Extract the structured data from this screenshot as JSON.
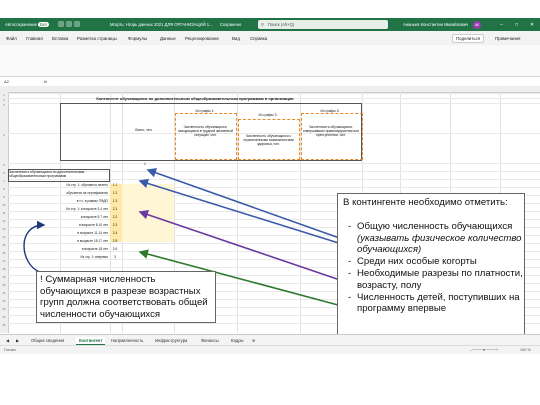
{
  "titlebar": {
    "autosave_label": "Автосохранение",
    "autosave_state": "Вкл",
    "doc_title": "Мгорть: Нгорь данных 2021 ДЛЯ ОРГАНИЗАЦИЙ 1...",
    "saved_status": "Сохранено",
    "search_placeholder": "Поиск (Alt+Q)",
    "user_name": "Ананьев Константин Михайлович",
    "user_initials": "АК"
  },
  "menu": {
    "items": [
      "Файл",
      "Главная",
      "Вставка",
      "Разметка страницы",
      "Формулы",
      "Данные",
      "Рецензирование",
      "Вид",
      "Справка"
    ],
    "share_label": "Поделиться",
    "comments_label": "Примечания"
  },
  "formula_bar": {
    "cell_ref": "A2",
    "fx": "fx"
  },
  "sheet": {
    "title": "Контингент обучающихся по дополнительным общеобразовательным программам в организации",
    "header_total": "Всего, чел.",
    "header_from_col1": "Из графы 1:",
    "header_from_col2": "Из графы 2:",
    "header_from_col3": "Из графы 3:",
    "header_difficult": "Численность обучающихся, находящихся в трудной жизненной ситуации, чел.",
    "header_disabled": "Численность обучающихся с ограниченными возможностями здоровья, чел.",
    "header_offenders": "Численность обучающихся, совершивших правонарушения или преступления, чел.",
    "col_number": "1",
    "total_row_label": "Численность обучающихся по дополнительным общеобразовательным программам",
    "sub_rows": [
      {
        "label": "Из стр. 1: обучаются платно",
        "num": "1.1"
      },
      {
        "label": "обучаются на сертификатах",
        "num": "1.2"
      },
      {
        "label": "в т.ч. в рамках ПФДО",
        "num": "1.3"
      },
      {
        "label": "Из стр. 1: в возрасте 3-4 лет",
        "num": "2.1"
      },
      {
        "label": "в возрасте 5-7 лет",
        "num": "2.2"
      },
      {
        "label": "в возрасте 8-10 лет",
        "num": "2.3"
      },
      {
        "label": "в возрасте 11-14 лет",
        "num": "2.4"
      },
      {
        "label": "в возрасте 15-17 лет",
        "num": "2.5"
      },
      {
        "label": "в возрасте 18 лет",
        "num": "2.6"
      },
      {
        "label": "Из стр. 1: впервые",
        "num": "3"
      }
    ],
    "row_numbers": [
      "1",
      "2",
      "3",
      "4",
      "5",
      "6",
      "7",
      "8",
      "9",
      "10",
      "11",
      "12",
      "13",
      "14",
      "15",
      "16",
      "17",
      "18",
      "19",
      "20",
      "21",
      "22",
      "23",
      "24",
      "25",
      "26",
      "27",
      "28",
      "29",
      "30"
    ]
  },
  "callout_right": {
    "heading": "В контингенте необходимо отметить:",
    "items": [
      {
        "text": "Общую численность обучающихся",
        "note": "(указывать физическое количество обучающихся)"
      },
      {
        "text": "Среди них особые когорты",
        "note": ""
      },
      {
        "text": "Необходимые разрезы по платности, возрасту, полу",
        "note": ""
      },
      {
        "text": "Численность детей, поступивших на программу впервые",
        "note": ""
      }
    ]
  },
  "callout_left": {
    "text": "! Суммарная численность обучающихся в разрезе возрастных групп должна соответствовать общей численности обучающихся"
  },
  "tabs": [
    "Общие сведения",
    "Контингент",
    "Направленность",
    "Инфраструктура",
    "Финансы",
    "Кадры"
  ],
  "active_tab": "Контингент",
  "status": {
    "ready": "Готово",
    "zoom": "100 %"
  },
  "colors": {
    "excel_green": "#217346",
    "arrow_blue": "#3b5aa8",
    "arrow_purple": "#6a3aa0",
    "arrow_green": "#2f7a2f",
    "highlight": "#ffe9a8"
  }
}
